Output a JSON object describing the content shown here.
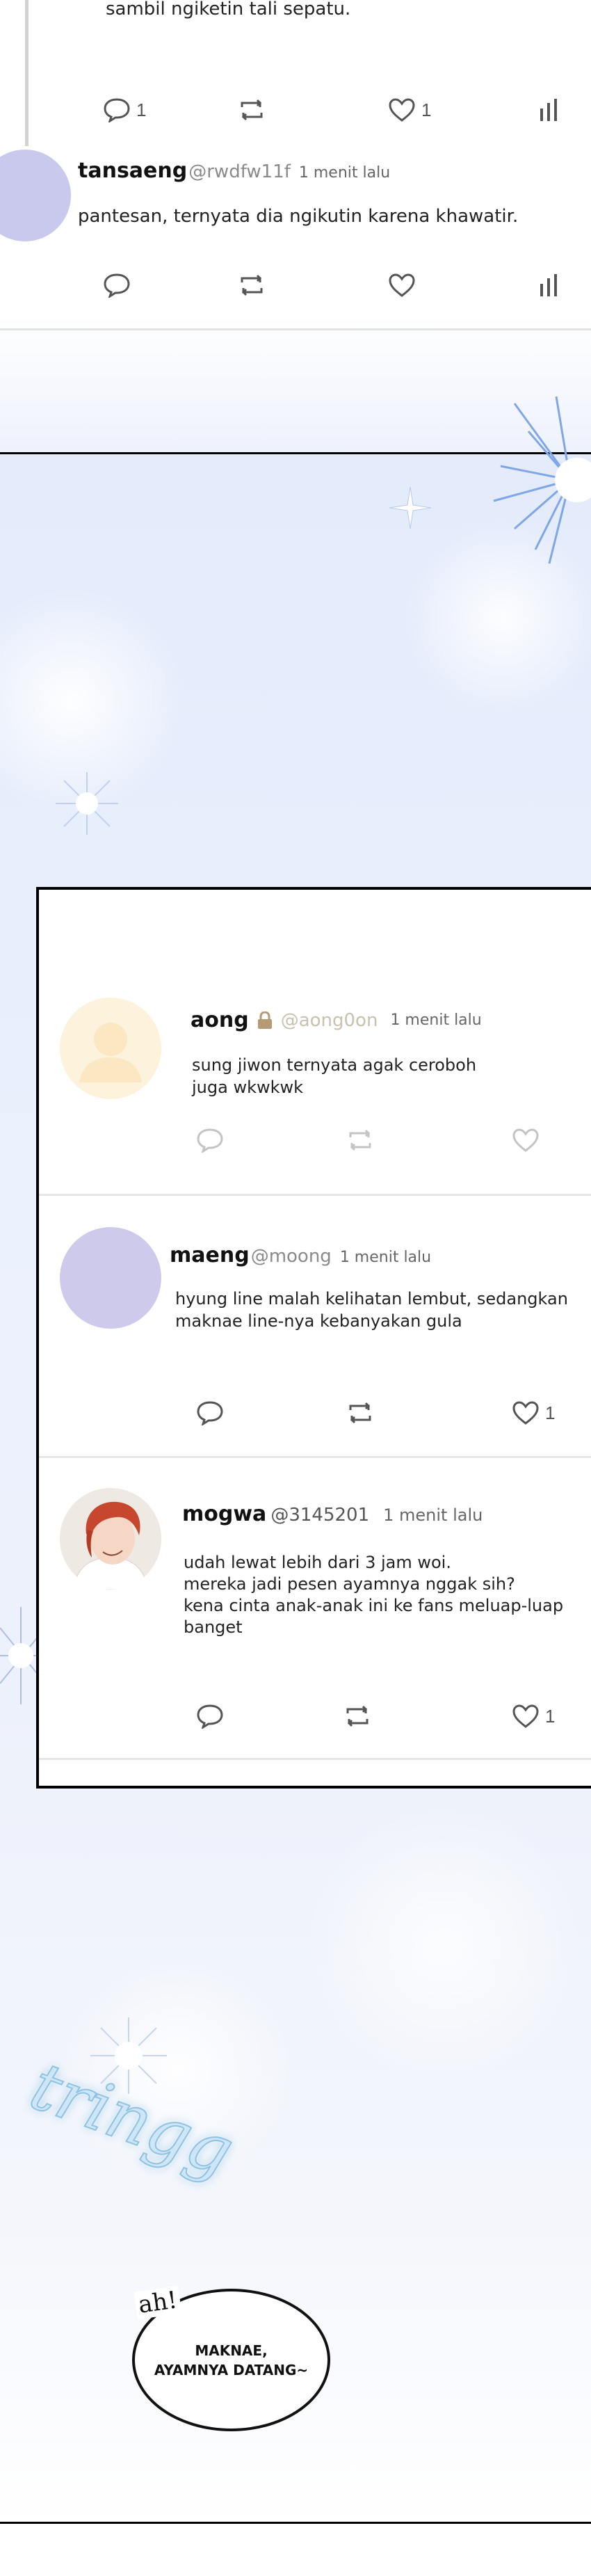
{
  "tweet_top": {
    "text": "sambil ngiketin tali sepatu.",
    "reply_count": "1",
    "like_count": "1"
  },
  "tweet_tansaeng": {
    "name": "tansaeng",
    "handle": "@rwdfw11f",
    "time": "1 menit lalu",
    "text": "pantesan, ternyata dia ngikutin karena khawatir."
  },
  "tweet_aong": {
    "name": "aong",
    "handle": "@aong0on",
    "time": "1 menit lalu",
    "text_line1": "sung jiwon ternyata agak ceroboh",
    "text_line2": "juga wkwkwk"
  },
  "tweet_maeng": {
    "name": "maeng",
    "handle": "@moong",
    "time": "1 menit lalu",
    "text_line1": "hyung line malah kelihatan lembut, sedangkan",
    "text_line2": "maknae line-nya kebanyakan gula",
    "like_count": "1"
  },
  "tweet_mogwa": {
    "name": "mogwa",
    "handle": "@3145201",
    "time": "1 menit lalu",
    "text_line1": "udah lewat lebih dari 3 jam woi.",
    "text_line2": "mereka jadi pesen ayamnya nggak sih?",
    "text_line3": "kena cinta anak-anak ini ke fans meluap-luap",
    "text_line4": "banget",
    "like_count": "1"
  },
  "speech": {
    "exclaim": "ah!",
    "line1": "MAKNAE,",
    "line2": "AYAMNYA DATANG~"
  },
  "sfx": "tringg",
  "colors": {
    "avatar_tansaeng": "#c9c9ee",
    "avatar_aong": "#fdf3dc",
    "avatar_maeng": "#cdcaec",
    "background_blue": "#e4ebfb"
  }
}
